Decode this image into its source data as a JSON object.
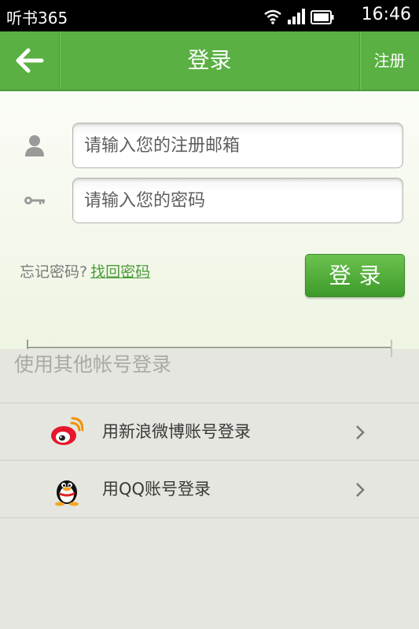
{
  "status_bar": {
    "app_name": "听书365",
    "time": "16:46",
    "icons": [
      "wifi-icon",
      "signal-icon",
      "battery-icon"
    ]
  },
  "header": {
    "back_icon": "back-arrow-icon",
    "title": "登录",
    "register_label": "注册"
  },
  "form": {
    "email_placeholder": "请输入您的注册邮箱",
    "email_icon": "user-icon",
    "password_placeholder": "请输入您的密码",
    "password_icon": "key-icon",
    "forgot_text": "忘记密码?",
    "forgot_link": "找回密码",
    "login_label": "登录"
  },
  "other_login": {
    "title": "使用其他帐号登录",
    "items": [
      {
        "label": "用新浪微博账号登录",
        "icon": "weibo-icon"
      },
      {
        "label": "用QQ账号登录",
        "icon": "qq-penguin-icon"
      }
    ]
  },
  "colors": {
    "accent": "#5ab043",
    "button": "#4fae38",
    "link": "#4b9a3a"
  }
}
